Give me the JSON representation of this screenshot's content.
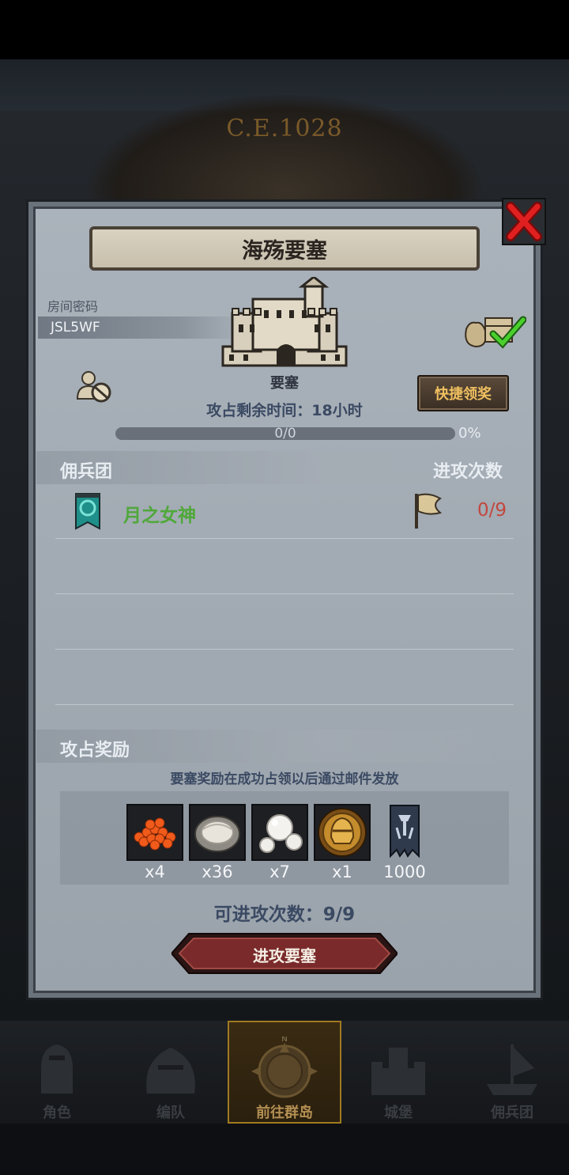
{
  "background": {
    "year_text": "C.E.1028"
  },
  "panel": {
    "title": "海殇要塞",
    "room_code_label": "房间密码",
    "room_code": "JSL5WF",
    "building_label": "要塞",
    "quick_claim_label": "快捷领奖",
    "time_remaining": "攻占剩余时间：18小时",
    "progress": {
      "text": "0/0",
      "percent_text": "0%",
      "value": 0
    },
    "mercenary_section_title": "佣兵团",
    "attack_count_header": "进攻次数",
    "mercenaries": [
      {
        "name": "月之女神",
        "count": "0/9"
      }
    ],
    "reward_section_title": "攻占奖励",
    "reward_note": "要塞奖励在成功占领以后通过邮件发放",
    "rewards": [
      {
        "icon": "roe-icon",
        "qty": "x4"
      },
      {
        "icon": "oyster-icon",
        "qty": "x36"
      },
      {
        "icon": "pearl-icon",
        "qty": "x7"
      },
      {
        "icon": "helmet-coin-icon",
        "qty": "x1"
      },
      {
        "icon": "guild-banner-icon",
        "qty": "1000"
      }
    ],
    "available_attacks": "可进攻次数：9/9",
    "attack_button_label": "进攻要塞"
  },
  "nav": {
    "items": [
      {
        "label": "角色"
      },
      {
        "label": "编队"
      },
      {
        "label": "前往群岛"
      },
      {
        "label": "城堡"
      },
      {
        "label": "佣兵团"
      }
    ],
    "compass_letter": "N"
  },
  "colors": {
    "merc_name": "#4fa83a",
    "merc_count": "#c2473e",
    "quick_btn_text": "#f0c060",
    "accent_gold": "#b38f52"
  }
}
